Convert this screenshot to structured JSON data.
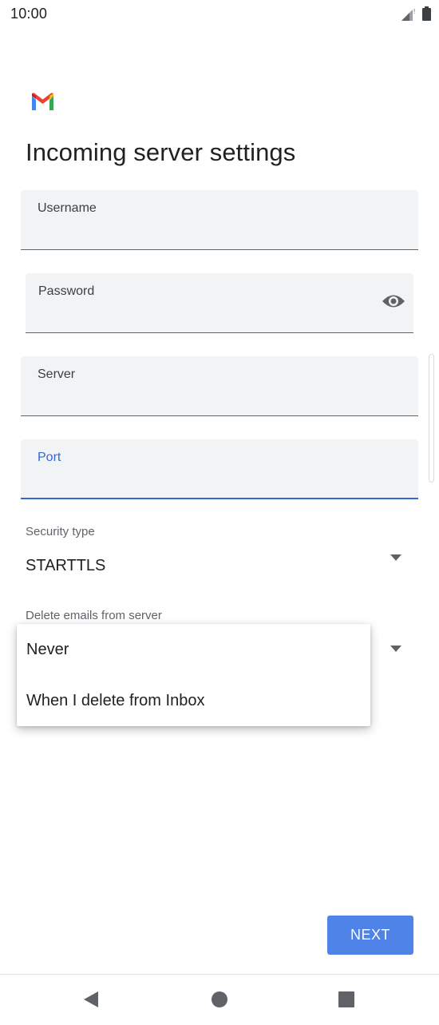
{
  "status_bar": {
    "time": "10:00"
  },
  "icons": {
    "signal": "signal-icon",
    "battery": "battery-icon",
    "logo": "gmail-logo-icon",
    "visibility": "eye-icon",
    "dropdown": "chevron-down-icon",
    "back": "back-icon",
    "home": "home-icon",
    "recents": "recents-icon"
  },
  "page": {
    "title": "Incoming server settings"
  },
  "fields": {
    "username": {
      "label": "Username",
      "value": ""
    },
    "password": {
      "label": "Password",
      "value": ""
    },
    "server": {
      "label": "Server",
      "value": ""
    },
    "port": {
      "label": "Port",
      "value": ""
    }
  },
  "security": {
    "label": "Security type",
    "value": "STARTTLS"
  },
  "delete_emails": {
    "label": "Delete emails from server",
    "options": [
      "Never",
      "When I delete from Inbox"
    ]
  },
  "actions": {
    "next_label": "NEXT"
  },
  "colors": {
    "accent": "#3367d6",
    "button": "#4f83e8",
    "field_bg": "#f1f3f4"
  }
}
